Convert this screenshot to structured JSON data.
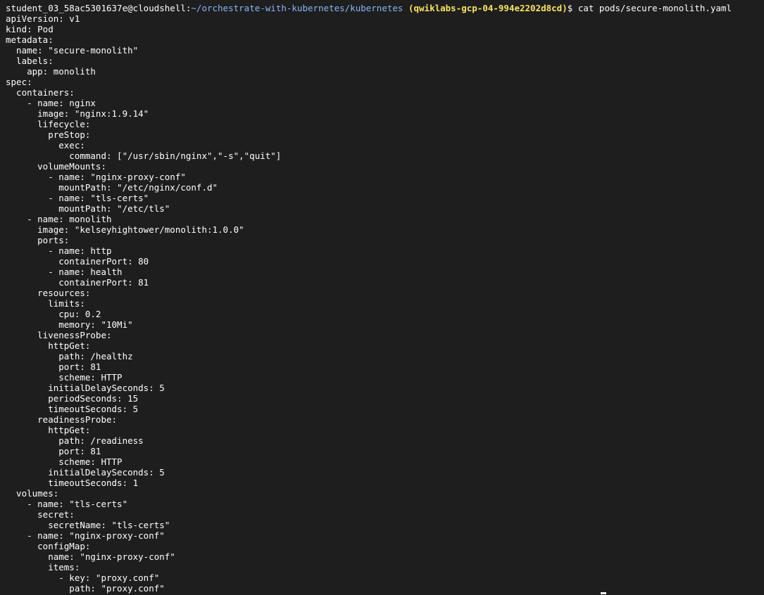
{
  "terminal": {
    "prompt": {
      "user_host": "student_03_58ac5301637e@cloudshell",
      "separator": ":",
      "path": "~/orchestrate-with-kubernetes/kubernetes",
      "project": "(qwiklabs-gcp-04-994e2202d8cd)",
      "symbol": "$",
      "command": "cat pods/secure-monolith.yaml"
    },
    "lines": [
      "apiVersion: v1",
      "kind: Pod",
      "metadata:",
      "  name: \"secure-monolith\"",
      "  labels:",
      "    app: monolith",
      "spec:",
      "  containers:",
      "    - name: nginx",
      "      image: \"nginx:1.9.14\"",
      "      lifecycle:",
      "        preStop:",
      "          exec:",
      "            command: [\"/usr/sbin/nginx\",\"-s\",\"quit\"]",
      "      volumeMounts:",
      "        - name: \"nginx-proxy-conf\"",
      "          mountPath: \"/etc/nginx/conf.d\"",
      "        - name: \"tls-certs\"",
      "          mountPath: \"/etc/tls\"",
      "    - name: monolith",
      "      image: \"kelseyhightower/monolith:1.0.0\"",
      "      ports:",
      "        - name: http",
      "          containerPort: 80",
      "        - name: health",
      "          containerPort: 81",
      "      resources:",
      "        limits:",
      "          cpu: 0.2",
      "          memory: \"10Mi\"",
      "      livenessProbe:",
      "        httpGet:",
      "          path: /healthz",
      "          port: 81",
      "          scheme: HTTP",
      "        initialDelaySeconds: 5",
      "        periodSeconds: 15",
      "        timeoutSeconds: 5",
      "      readinessProbe:",
      "        httpGet:",
      "          path: /readiness",
      "          port: 81",
      "          scheme: HTTP",
      "        initialDelaySeconds: 5",
      "        timeoutSeconds: 1",
      "  volumes:",
      "    - name: \"tls-certs\"",
      "      secret:",
      "        secretName: \"tls-certs\"",
      "    - name: \"nginx-proxy-conf\"",
      "      configMap:",
      "        name: \"nginx-proxy-conf\"",
      "        items:",
      "          - key: \"proxy.conf\"",
      "            path: \"proxy.conf\""
    ]
  }
}
